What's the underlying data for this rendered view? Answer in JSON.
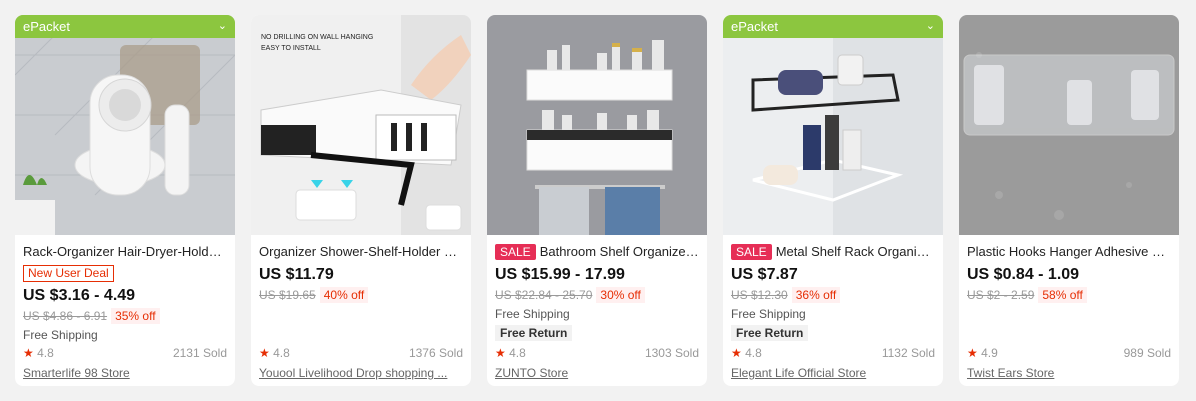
{
  "products": [
    {
      "epacket": "ePacket",
      "title": "Rack-Organizer Hair-Dryer-Holder ...",
      "deal": "New User Deal",
      "price": "US $3.16 - 4.49",
      "original": "US $4.86 - 6.91",
      "discount": "35% off",
      "shipping": "Free Shipping",
      "rating": "4.8",
      "sold": "2131 Sold",
      "store": "Smarterlife 98 Store"
    },
    {
      "title": "Organizer Shower-Shelf-Holder St...",
      "price": "US $11.79",
      "original": "US $19.65",
      "discount": "40% off",
      "rating": "4.8",
      "sold": "1376 Sold",
      "store": "Youool Livelihood Drop shopping ...",
      "image_text": "NO DRILLING ON WALL HANGING\nEASY TO INSTALL"
    },
    {
      "sale": "SALE",
      "title": "Bathroom Shelf Organizer...",
      "price": "US $15.99 - 17.99",
      "original": "US $22.84 - 25.70",
      "discount": "30% off",
      "shipping": "Free Shipping",
      "return": "Free Return",
      "rating": "4.8",
      "sold": "1303 Sold",
      "store": "ZUNTO Store"
    },
    {
      "epacket": "ePacket",
      "sale": "SALE",
      "title": "Metal Shelf Rack Organize...",
      "price": "US $7.87",
      "original": "US $12.30",
      "discount": "36% off",
      "shipping": "Free Shipping",
      "return": "Free Return",
      "rating": "4.8",
      "sold": "1132 Sold",
      "store": "Elegant Life Official Store"
    },
    {
      "title": "Plastic Hooks Hanger Adhesive Bat...",
      "price": "US $0.84 - 1.09",
      "original": "US $2 - 2.59",
      "discount": "58% off",
      "rating": "4.9",
      "sold": "989 Sold",
      "store": "Twist Ears Store"
    }
  ],
  "colors": {
    "accent": "#e62e04",
    "epacket": "#8cc63f",
    "sale": "#e62e56"
  },
  "icons": {
    "star": "star-icon",
    "chevron": "chevron-down-icon"
  }
}
